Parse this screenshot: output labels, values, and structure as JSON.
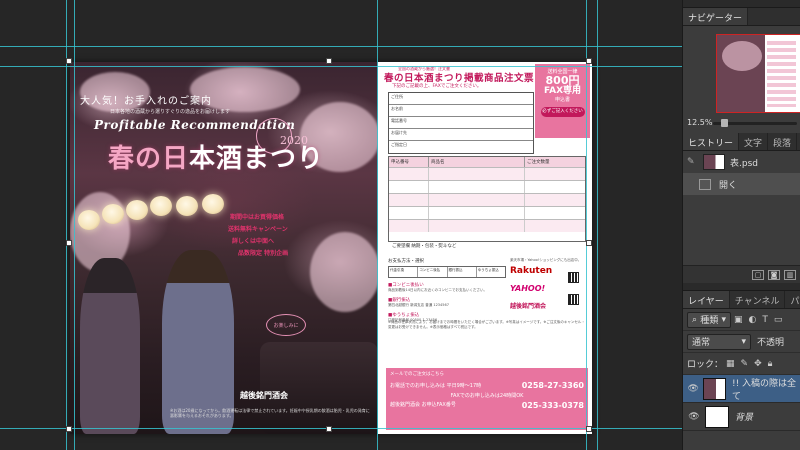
{
  "document": {
    "front": {
      "kicker": "大人気！お手入れのご案内",
      "subline": "日本各地の酒蔵から選りすぐりの逸品をお届けします",
      "en_title": "Profitable Recommendation",
      "title_a": "春の日",
      "title_b": "本酒まつり",
      "year": "2020",
      "red_lines": [
        "期間中はお買得価格",
        "送料無料キャンペーン",
        "詳しくは中面へ",
        "品数限定 特別企画"
      ],
      "stamp": "お楽しみに",
      "brand": "越後銘門酒会",
      "fine_print": "※お酒は20歳になってから。飲酒運転は法律で禁止されています。妊娠中や授乳期の飲酒は胎児・乳児の発育に悪影響を与えるおそれがあります。"
    },
    "back": {
      "header_note": "全国の酒蔵から厳選！注文書",
      "title": "春の日本酒まつり掲載商品注文票",
      "title_sub": "下記のご記載の上、FAXでご注文ください。",
      "fax_box": {
        "l1": "送料全国一律",
        "l2": "800円",
        "l3": "FAX専用",
        "l4": "申込書",
        "btn": "必ずご記入ください"
      },
      "addr_rows": [
        "ご住所",
        "お名前",
        "電話番号",
        "お届け先",
        "ご指定日"
      ],
      "order_headers": [
        "申込番号",
        "商品名",
        "ご注文数量"
      ],
      "order_note": "ご要望欄  納期・包装・熨斗など",
      "pay_header": "お支払方法・選択",
      "pay_options": [
        "代金引換",
        "コンビニ後払",
        "銀行振込",
        "ゆうちょ振込"
      ],
      "pay_items": [
        "■コンビニ後払い",
        "■銀行振込",
        "■ゆうちょ振込"
      ],
      "pay_texts": [
        "商品到着後14日以内にお近くのコンビニでお支払いください。",
        "第四北越銀行 新潟支店 普通 1234567",
        "口座記号番号 00500-1-23456"
      ],
      "logo_note": "楽天市場・Yahoo!ショッピングにも出店中。",
      "rakuten": "Rakuten",
      "yahoo": "YAHOO!",
      "shop": "越後銘門酒会",
      "notice": "※商品の在庫状況により、お届けまでお時間をいただく場合がございます。※写真はイメージです。※ご注文後のキャンセル・変更はお受けできません。※表示価格はすべて税込です。",
      "footer": {
        "l1": "メールでのご注文はこちら",
        "l2": "お電話でのお申し込みは 平日9時〜17時",
        "phone": "0258-27-3360",
        "l3": "FAXでのお申し込みは24時間OK",
        "l4": "越後銘門酒会 お申込FAX番号",
        "fax": "025-333-0378"
      }
    }
  },
  "panels": {
    "navigator": {
      "tab": "ナビゲーター",
      "zoom": "12.5%"
    },
    "history": {
      "tabs": [
        "ヒストリー",
        "文字",
        "段落"
      ],
      "items": [
        {
          "label": "表.psd",
          "type": "snapshot"
        },
        {
          "label": "開く",
          "type": "step"
        }
      ]
    },
    "layers": {
      "tabs": [
        "レイヤー",
        "チャンネル",
        "パス"
      ],
      "filter_label": "種類",
      "blend_mode": "通常",
      "opacity_label": "不透明",
      "lock_label": "ロック：",
      "items": [
        {
          "name": "!! 入稿の際は全て",
          "selected": true
        },
        {
          "name": "背景",
          "selected": false
        }
      ]
    }
  },
  "colors": {
    "accent": "#e8749f",
    "guide": "#37c3d0",
    "deep_pink": "#c2185b"
  }
}
